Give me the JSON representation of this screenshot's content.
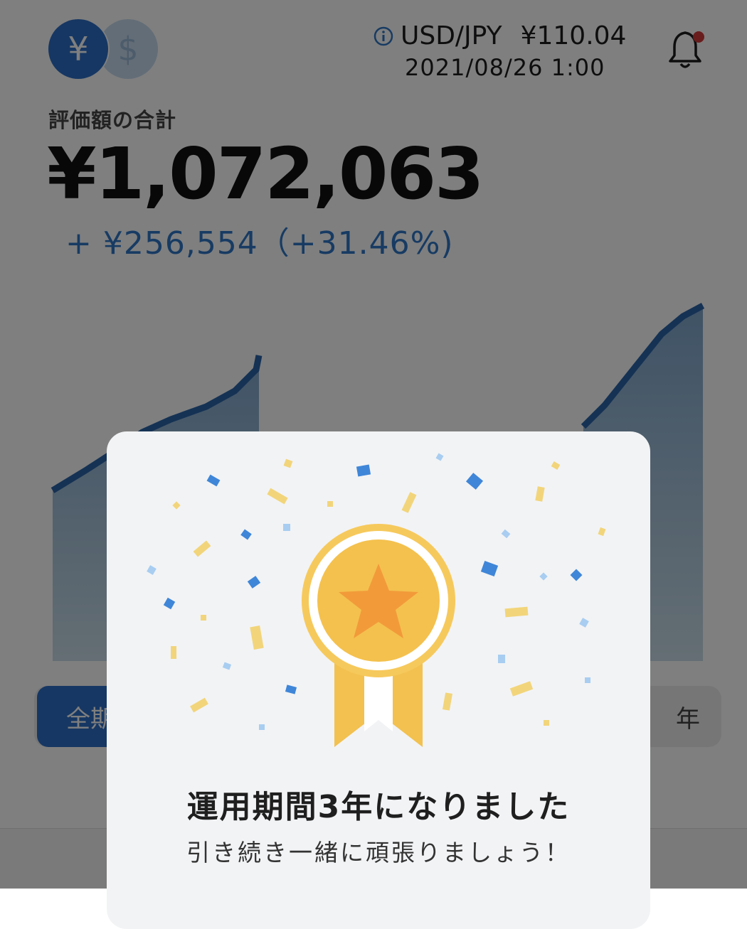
{
  "header": {
    "currency_toggle": {
      "active": "¥",
      "inactive": "$"
    },
    "rate_pair": "USD/JPY",
    "rate_value": "¥110.04",
    "rate_datetime": "2021/08/26 1:00",
    "notification_dot_color": "#d33a3a"
  },
  "portfolio": {
    "total_label": "評価額の合計",
    "total_value": "¥1,072,063",
    "change_text": "+ ¥256,554（+31.46%)"
  },
  "period_tabs": {
    "all_label": "全期",
    "year_label": "年"
  },
  "colors": {
    "accent": "#2d6fc7",
    "gain": "#2f76c6",
    "medal": "#f4c14e",
    "star": "#f29a3a"
  },
  "modal": {
    "title": "運用期間3年になりました",
    "subtitle": "引き続き一緒に頑張りましょう！",
    "icon": "medal-star-icon"
  }
}
